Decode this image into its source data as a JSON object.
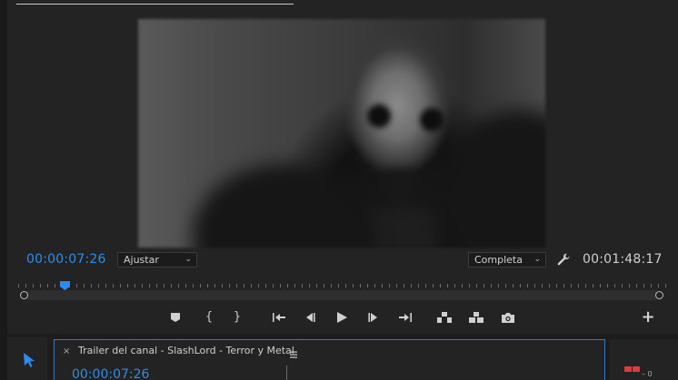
{
  "program_monitor": {
    "current_timecode": "00:00:07:26",
    "duration_timecode": "00:01:48:17",
    "fit_dropdown": "Ajustar",
    "quality_dropdown": "Completa"
  },
  "transport_controls": [
    {
      "name": "add-marker",
      "icon": "marker-icon"
    },
    {
      "name": "mark-in",
      "icon": "mark-in-icon",
      "glyph": "{"
    },
    {
      "name": "mark-out",
      "icon": "mark-out-icon",
      "glyph": "}"
    },
    {
      "name": "go-to-in",
      "icon": "go-to-in-icon"
    },
    {
      "name": "step-back",
      "icon": "step-back-icon"
    },
    {
      "name": "play",
      "icon": "play-icon"
    },
    {
      "name": "step-forward",
      "icon": "step-forward-icon"
    },
    {
      "name": "go-to-out",
      "icon": "go-to-out-icon"
    },
    {
      "name": "lift",
      "icon": "lift-icon"
    },
    {
      "name": "extract",
      "icon": "extract-icon"
    },
    {
      "name": "export-frame",
      "icon": "camera-icon"
    },
    {
      "name": "add-button",
      "icon": "plus-icon",
      "glyph": "+"
    }
  ],
  "timeline": {
    "tab_close": "×",
    "sequence_title": "Trailer del canal - SlashLord - Terror y Metal",
    "timecode": "00:00:07:26"
  },
  "audio_meter": {
    "zero_label": "0"
  },
  "colors": {
    "accent_blue": "#2d8ceb",
    "panel_bg": "#232323",
    "clip_red": "#e03a3a"
  }
}
